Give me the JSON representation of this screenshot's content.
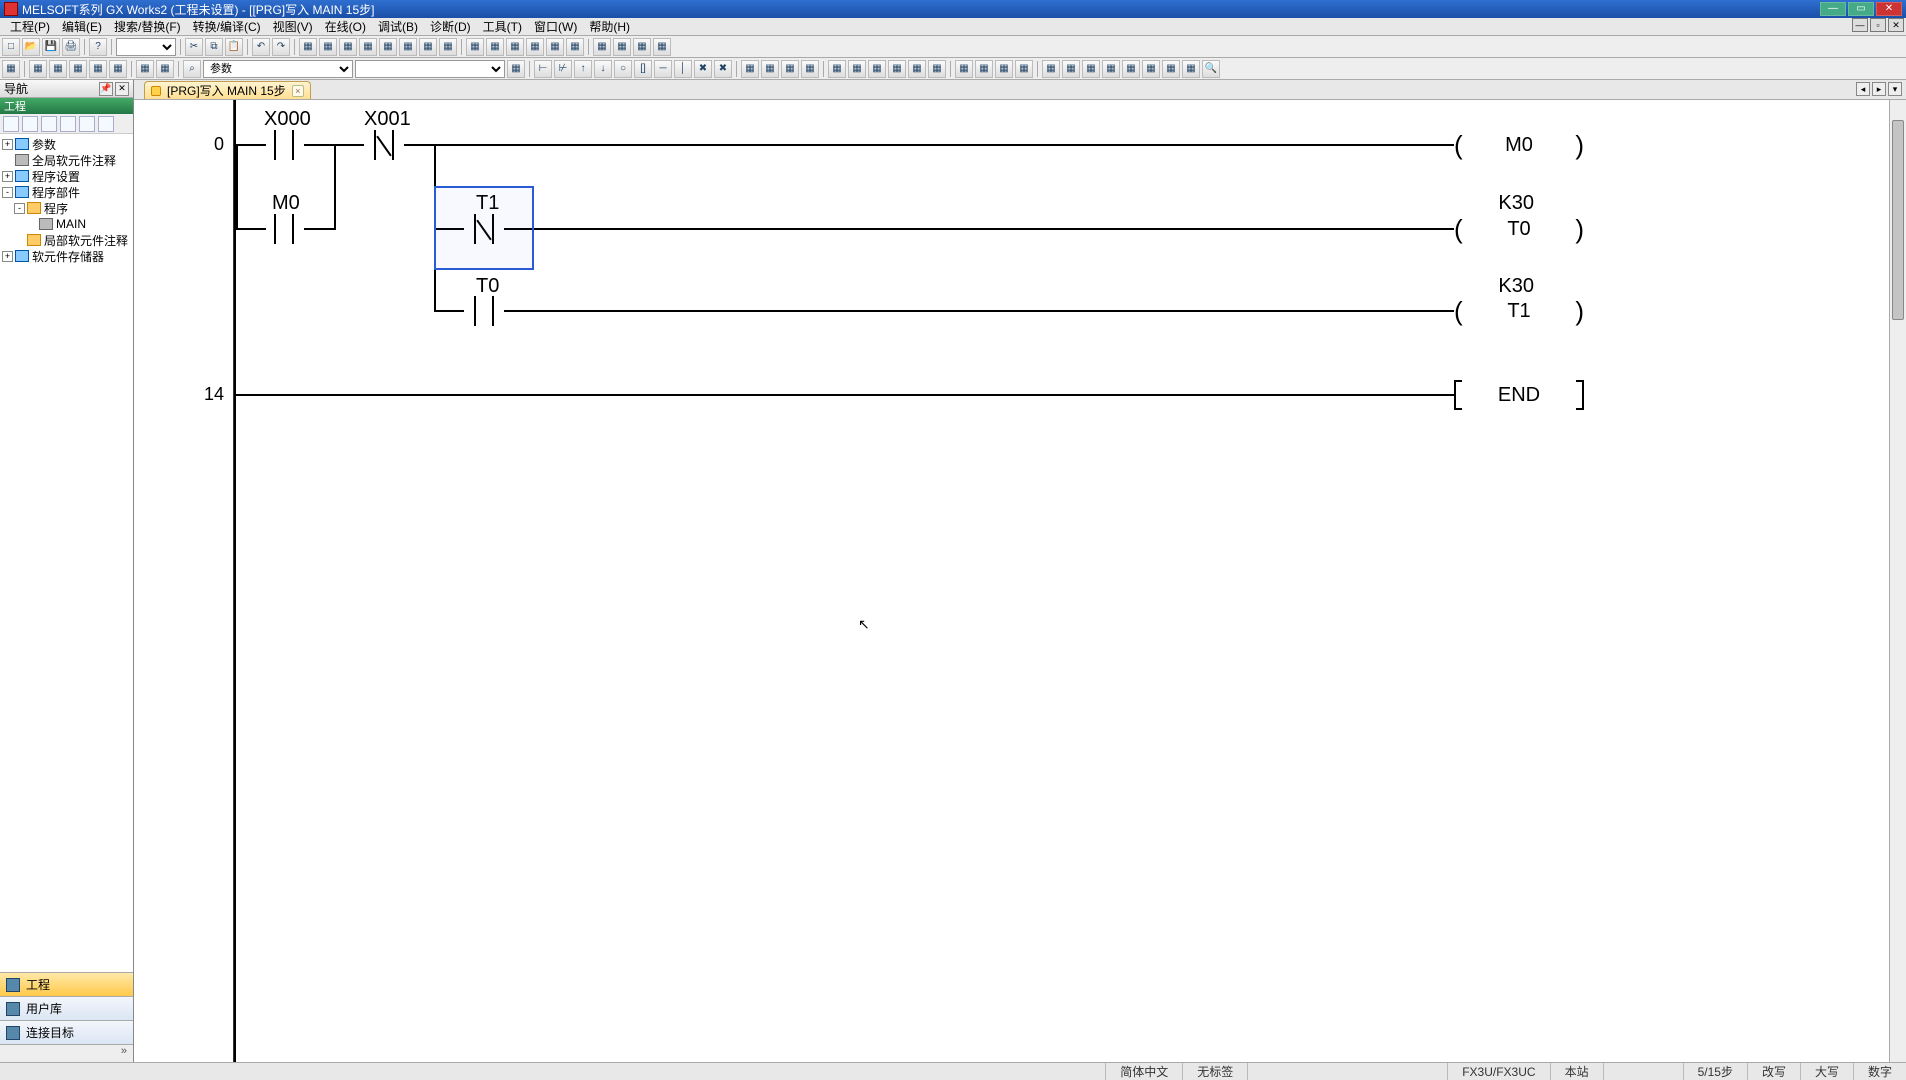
{
  "window": {
    "title": "MELSOFT系列 GX Works2 (工程未设置) - [[PRG]写入 MAIN 15步]",
    "min": "—",
    "max": "▭",
    "close": "✕"
  },
  "mdi": {
    "min": "—",
    "max": "▫",
    "close": "✕"
  },
  "menu": {
    "items": [
      "工程(P)",
      "编辑(E)",
      "搜索/替换(F)",
      "转换/编译(C)",
      "视图(V)",
      "在线(O)",
      "调试(B)",
      "诊断(D)",
      "工具(T)",
      "窗口(W)",
      "帮助(H)"
    ]
  },
  "toolbar1": {
    "combo1_value": "",
    "icons": [
      "new",
      "open",
      "save",
      "print",
      "help",
      "|",
      "cut",
      "copy",
      "paste",
      "undo",
      "redo",
      "|",
      "a",
      "b",
      "c",
      "d",
      "e",
      "f",
      "g",
      "h",
      "i",
      "j",
      "k",
      "l",
      "m",
      "n",
      "o",
      "p",
      "q"
    ]
  },
  "toolbar2": {
    "btn_group_a": [
      "t1",
      "t2",
      "t3",
      "t4",
      "t5",
      "t6",
      "t7",
      "t8",
      "t9"
    ],
    "find_icon": "⌕",
    "combo_device_label": "参数",
    "combo2_value": "",
    "btn_group_b": [
      "b1",
      "b2",
      "b3",
      "b4",
      "b5",
      "b6",
      "b7",
      "b8",
      "b9",
      "b10",
      "b11",
      "b12",
      "b13",
      "b14",
      "b15",
      "b16",
      "b17",
      "b18",
      "b19",
      "b20",
      "b21",
      "b22",
      "b23",
      "b24",
      "b25",
      "b26",
      "b27",
      "b28",
      "b29",
      "b30",
      "b31",
      "b32",
      "b33",
      "b34",
      "b35"
    ]
  },
  "nav": {
    "title": "导航",
    "pin": "📌",
    "close": "✕",
    "band": "工程",
    "tree": [
      {
        "tw": "+",
        "ic": "blue",
        "label": "参数",
        "ind": 0
      },
      {
        "tw": "",
        "ic": "g",
        "label": "全局软元件注释",
        "ind": 0
      },
      {
        "tw": "+",
        "ic": "blue",
        "label": "程序设置",
        "ind": 0
      },
      {
        "tw": "-",
        "ic": "blue",
        "label": "程序部件",
        "ind": 0
      },
      {
        "tw": "-",
        "ic": "",
        "label": "程序",
        "ind": 1
      },
      {
        "tw": "",
        "ic": "g",
        "label": "MAIN",
        "ind": 2
      },
      {
        "tw": "",
        "ic": "",
        "label": "局部软元件注释",
        "ind": 1
      },
      {
        "tw": "+",
        "ic": "blue",
        "label": "软元件存储器",
        "ind": 0
      }
    ],
    "tasks": [
      {
        "label": "工程",
        "active": true
      },
      {
        "label": "用户库",
        "active": false
      },
      {
        "label": "连接目标",
        "active": false
      }
    ],
    "footer": "»"
  },
  "tab": {
    "label": "[PRG]写入 MAIN 15步",
    "close": "×",
    "nav_prev": "◂",
    "nav_next": "▸",
    "menu": "▾"
  },
  "ladder": {
    "step0": "0",
    "step14": "14",
    "X000": "X000",
    "X001": "X001",
    "M0_contact": "M0",
    "T1_contact": "T1",
    "T0_contact": "T0",
    "M0_coil": "M0",
    "T0_coil": "T0",
    "T1_coil": "T1",
    "K30_a": "K30",
    "K30_b": "K30",
    "END": "END",
    "coil_l": "(",
    "coil_r": ")"
  },
  "status": {
    "lang": "简体中文",
    "label": "无标签",
    "plc": "FX3U/FX3UC",
    "station": "本站",
    "steps": "5/15步",
    "mode": "改写",
    "caps": "大写",
    "num": "数字"
  },
  "cursor_glyph": "↖"
}
